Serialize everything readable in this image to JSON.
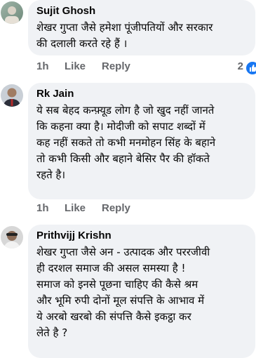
{
  "comments": [
    {
      "author": "Sujit Ghosh",
      "text": "शेखर गुप्ता जैसे हमेशा पूंजीपतियों और सरकार\nकी दलाली करते रहे हैं ।",
      "time": "1h",
      "like_label": "Like",
      "reply_label": "Reply",
      "reaction_count": "2",
      "avatar_icon": "avatar-photo"
    },
    {
      "author": "Rk Jain",
      "text": "ये सब बेहद कन्फ़्यूड लोग है जो खुद नहीं जानते\nकि कहना क्या है। मोदीजी को सपाट शब्दों में\nकह नहीं सकते तो कभी मनमोहन सिंह के बहाने\nतो कभी किसी और बहाने बेसिर पैर की हॉकते\nरहते है।",
      "time": "1h",
      "like_label": "Like",
      "reply_label": "Reply",
      "avatar_icon": "avatar-photo"
    },
    {
      "author": "Prithvijj Krishn",
      "text": "शेखर गुप्ता  जैसे अन - उत्पादक  और पररजीवी\nही दरशल समाज  की असल  समस्या  है !\nसमाज को इनसे पूछना  चाहिए की कैसे श्रम\nऔर भूमि  रुपी  दोनों मूल संपत्ति  के आभाव में\nये अरबो  खरबो  की संपत्ति  कैसे  इकट्ठा कर\nलेते है ?",
      "avatar_icon": "avatar-photo"
    }
  ],
  "colors": {
    "bubble_bg": "#f0f2f5",
    "meta_text": "#65676b",
    "like_blue": "#1877f2"
  }
}
